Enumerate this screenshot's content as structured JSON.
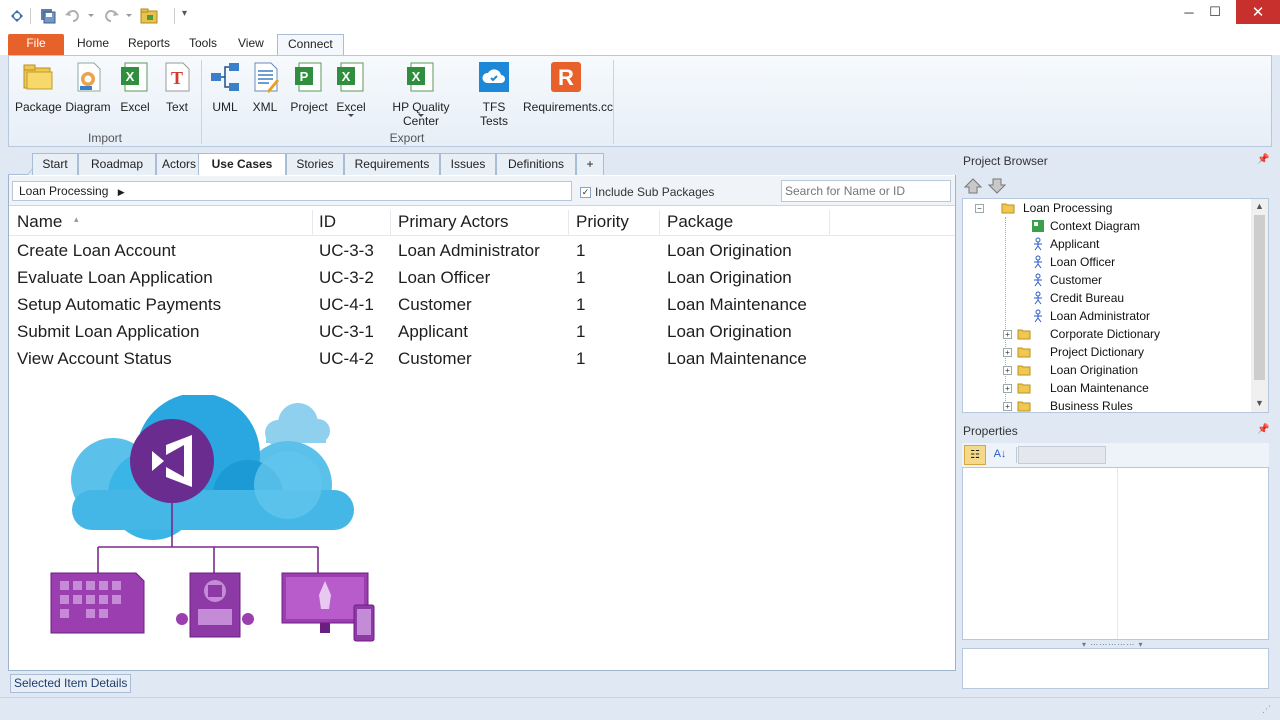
{
  "quick_access": {
    "icons": [
      "app-logo-icon",
      "save-all-icon",
      "undo-icon",
      "redo-icon",
      "open-folder-icon",
      "customize-toolbar-icon"
    ]
  },
  "window": {
    "minimize_glyph": "─",
    "maximize_glyph": "☐",
    "close_glyph": "✕"
  },
  "ribbon_tabs": [
    "File",
    "Home",
    "Reports",
    "Tools",
    "View",
    "Connect"
  ],
  "ribbon": {
    "import": {
      "label": "Import",
      "buttons": [
        "Package",
        "Diagram",
        "Excel",
        "Text"
      ]
    },
    "export": {
      "label": "Export",
      "buttons": [
        "UML",
        "XML",
        "Project",
        "Excel",
        "HP Quality Center",
        "TFS Tests",
        "Requirements.cc"
      ]
    }
  },
  "doc_tabs": [
    "Start",
    "Roadmap",
    "Actors",
    "Use Cases",
    "Stories",
    "Requirements",
    "Issues",
    "Definitions",
    "+"
  ],
  "toolbar": {
    "breadcrumb": "Loan Processing",
    "include_sub_packages": "Include Sub Packages",
    "search_placeholder": "Search for Name or ID"
  },
  "grid": {
    "columns": [
      "Name",
      "ID",
      "Primary Actors",
      "Priority",
      "Package"
    ],
    "rows": [
      [
        "Create Loan Account",
        "UC-3-3",
        "Loan Administrator",
        "1",
        "Loan Origination"
      ],
      [
        "Evaluate Loan Application",
        "UC-3-2",
        "Loan Officer",
        "1",
        "Loan Origination"
      ],
      [
        "Setup Automatic Payments",
        "UC-4-1",
        "Customer",
        "1",
        "Loan Maintenance"
      ],
      [
        "Submit Loan Application",
        "UC-3-1",
        "Applicant",
        "1",
        "Loan Origination"
      ],
      [
        "View Account Status",
        "UC-4-2",
        "Customer",
        "1",
        "Loan Maintenance"
      ]
    ]
  },
  "bottom": {
    "selected_item_details": "Selected Item Details"
  },
  "project_browser": {
    "title": "Project Browser",
    "root": "Loan Processing",
    "items": [
      {
        "label": "Context Diagram",
        "icon": "diagram-icon"
      },
      {
        "label": "Applicant",
        "icon": "actor-icon"
      },
      {
        "label": "Loan Officer",
        "icon": "actor-icon"
      },
      {
        "label": "Customer",
        "icon": "actor-icon"
      },
      {
        "label": "Credit Bureau",
        "icon": "actor-icon"
      },
      {
        "label": "Loan Administrator",
        "icon": "actor-icon"
      },
      {
        "label": "Corporate Dictionary",
        "icon": "folder-icon"
      },
      {
        "label": "Project Dictionary",
        "icon": "folder-icon"
      },
      {
        "label": "Loan Origination",
        "icon": "folder-icon"
      },
      {
        "label": "Loan Maintenance",
        "icon": "folder-icon"
      },
      {
        "label": "Business Rules",
        "icon": "folder-icon"
      }
    ]
  },
  "properties": {
    "title": "Properties"
  },
  "colors": {
    "file_tab": "#e6622a",
    "close_button": "#c7302c",
    "illustration_purple": "#7a2b8c",
    "cloud_blue": "#2aa7e0"
  }
}
